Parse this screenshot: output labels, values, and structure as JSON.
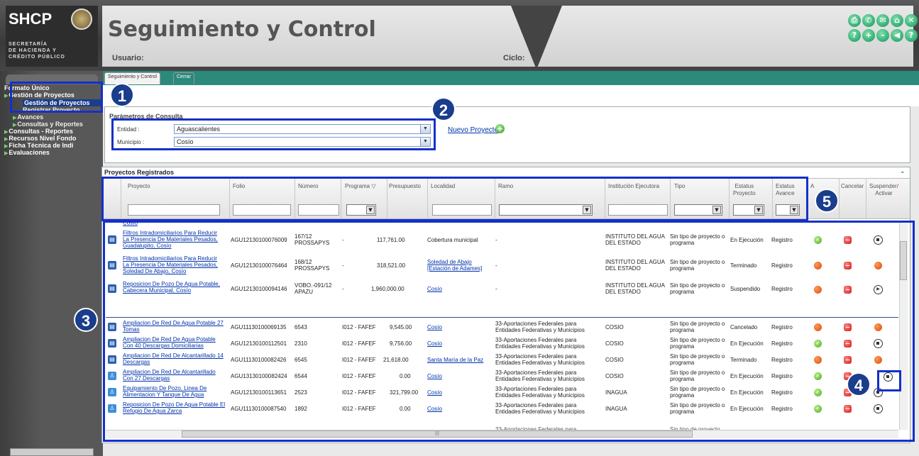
{
  "header": {
    "logo": "SHCP",
    "secretaria_lines": "SECRETARÍA\nDE HACIENDA Y\nCRÉDITO PÚBLICO",
    "app_title": "Seguimiento y Control",
    "usuario_label": "Usuario:",
    "ciclo_label": "Ciclo:",
    "toolbar_icons": [
      "print-icon",
      "phone-icon",
      "mail-icon",
      "home-icon",
      "close-icon",
      "help-icon",
      "add-icon",
      "minus-icon",
      "back-icon",
      "question-icon"
    ]
  },
  "nav": {
    "items": [
      {
        "label": "Formato Único",
        "level": 0
      },
      {
        "label": "Gestión de Proyectos",
        "level": 1
      },
      {
        "label": "Gestión de Proyectos",
        "level": 2,
        "selected": true
      },
      {
        "label": "Registrar Proyecto",
        "level": 2
      },
      {
        "label": "Avances",
        "level": 1
      },
      {
        "label": "Consultas y Reportes",
        "level": 1
      },
      {
        "label": "Consultas - Reportes",
        "level": 0
      },
      {
        "label": "Recursos Nivel Fondo",
        "level": 0
      },
      {
        "label": "Ficha Técnica de Indi",
        "level": 0
      },
      {
        "label": "Evaluaciones",
        "level": 0
      }
    ]
  },
  "tabs": {
    "seguimiento": "Seguimiento y Control",
    "cerrar": "Cerrar"
  },
  "params": {
    "legend": "Parámetros de Consulta",
    "entidad_label": "Entidad :",
    "entidad_value": "Aguascalientes",
    "municipio_label": "Municipio :",
    "municipio_value": "Cosío",
    "nuevo_proyecto": "Nuevo Proyecto"
  },
  "grid": {
    "title": "Proyectos Registrados",
    "columns": [
      "Proyecto",
      "Folio",
      "Número",
      "Programa",
      "Presupuesto",
      "Localidad",
      "Ramo",
      "Institución Ejecutora",
      "Tipo",
      "Estatus\nProyecto",
      "Estatus\nAvance",
      "A",
      "Cancelar",
      "Suspender/\nActivar"
    ],
    "top_cutoff": "Cosío",
    "rows": [
      {
        "proyecto": "Filtros Intradomiciliarios Para Reducir La Presencia De Materiales Pesados, Guadalupito, Cosío",
        "folio": "AGU12130100076009",
        "numero": "167/12 PROSSAPYS",
        "programa": "-",
        "presupuesto": "117,761.00",
        "localidad": "Cobertura municipal",
        "ramo": "-",
        "institucion": "INSTITUTO DEL AGUA DEL ESTADO",
        "tipo": "Sin tipo de proyecto o programa",
        "estatus": "En Ejecución",
        "avance": "Registro"
      },
      {
        "proyecto": "Filtros Intradomiciliarios Para Reducir La Presencia De Materiales Pesados, Soledad De Abajo, Cosío",
        "folio": "AGU12130100076464",
        "numero": "168/12 PROSSAPYS",
        "programa": "-",
        "presupuesto": "318,521.00",
        "localidad": "Soledad de Abajo [Estación de Adames]",
        "ramo": "-",
        "institucion": "INSTITUTO DEL AGUA DEL ESTADO",
        "tipo": "Sin tipo de proyecto o programa",
        "estatus": "Terminado",
        "avance": "Registro"
      },
      {
        "proyecto": "Reposicion De Pozo De Agua Potable, Cabecera Municipal, Cosío",
        "folio": "AGU12130100094146",
        "numero": "VOBO.-091/12 APAZU",
        "programa": "-",
        "presupuesto": "1,960,000.00",
        "localidad": "Cosío",
        "ramo": "-",
        "institucion": "INSTITUTO DEL AGUA DEL ESTADO",
        "tipo": "Sin tipo de proyecto o programa",
        "estatus": "Suspendido",
        "avance": "Registro"
      },
      {
        "proyecto": "Ampliacion De Red De Agua Potable 27 Tomas",
        "folio": "AGU11130100069135",
        "numero": "6543",
        "programa": "I012 - FAFEF",
        "presupuesto": "9,545.00",
        "localidad": "Cosío",
        "ramo": "33-Aportaciones Federales para Entidades Federativas y Municipios",
        "institucion": "COSIO",
        "tipo": "Sin tipo de proyecto o programa",
        "estatus": "Cancelado",
        "avance": "Registro"
      },
      {
        "proyecto": "Ampliacion De Red De Agua Potable Con 40 Descargas Domiciliarias",
        "folio": "AGU12130100112501",
        "numero": "2310",
        "programa": "I012 - FAFEF",
        "presupuesto": "9,756.00",
        "localidad": "Cosío",
        "ramo": "33-Aportaciones Federales para Entidades Federativas y Municipios",
        "institucion": "COSIO",
        "tipo": "Sin tipo de proyecto o programa",
        "estatus": "En Ejecución",
        "avance": "Registro"
      },
      {
        "proyecto": "Ampliacion De Red De Alcantarillado 14 Descargas",
        "folio": "AGU11130100082426",
        "numero": "6545",
        "programa": "I012 - FAFEF",
        "presupuesto": "21,618.00",
        "localidad": "Santa María de la Paz",
        "ramo": "33-Aportaciones Federales para Entidades Federativas y Municipios",
        "institucion": "COSIO",
        "tipo": "Sin tipo de proyecto o programa",
        "estatus": "Terminado",
        "avance": "Registro"
      },
      {
        "proyecto": "Ampliacion De Red De Alcantarillado Con 27 Descargas",
        "folio": "AGU13130100082424",
        "numero": "6544",
        "programa": "I012 - FAFEF",
        "presupuesto": "0.00",
        "localidad": "Cosío",
        "ramo": "33-Aportaciones Federales para Entidades Federativas y Municipios",
        "institucion": "COSIO",
        "tipo": "Sin tipo de proyecto o programa",
        "estatus": "En Ejecución",
        "avance": "Registro"
      },
      {
        "proyecto": "Equipamiento De Pozo, Linea De Alimentacion Y Tanque De Agua",
        "folio": "AGU12130100113651",
        "numero": "2523",
        "programa": "I012 - FAFEF",
        "presupuesto": "321,799.00",
        "localidad": "Cosío",
        "ramo": "33-Aportaciones Federales para Entidades Federativas y Municipios",
        "institucion": "INAGUA",
        "tipo": "Sin tipo de proyecto o programa",
        "estatus": "En Ejecución",
        "avance": "Registro"
      },
      {
        "proyecto": "Reposicion De Pozo De Agua Potable El Refugio De Agua Zarca",
        "folio": "AGU11130100087540",
        "numero": "1892",
        "programa": "I012 - FAFEF",
        "presupuesto": "0.00",
        "localidad": "Cosío",
        "ramo": "33-Aportaciones Federales para Entidades Federativas y Municipios",
        "institucion": "INAGUA",
        "tipo": "Sin tipo de proyecto o programa",
        "estatus": "En Ejecución",
        "avance": "Registro"
      }
    ],
    "bottom_cutoff_ramo": "33-Aportaciones Federales para",
    "bottom_cutoff_tipo": "Sin tipo de proyecto"
  },
  "callouts": [
    "1",
    "2",
    "3",
    "4",
    "5"
  ],
  "colors": {
    "accent_blue": "#1530c8",
    "teal": "#2c8a7c",
    "callout_bg": "#1a3d8c"
  }
}
